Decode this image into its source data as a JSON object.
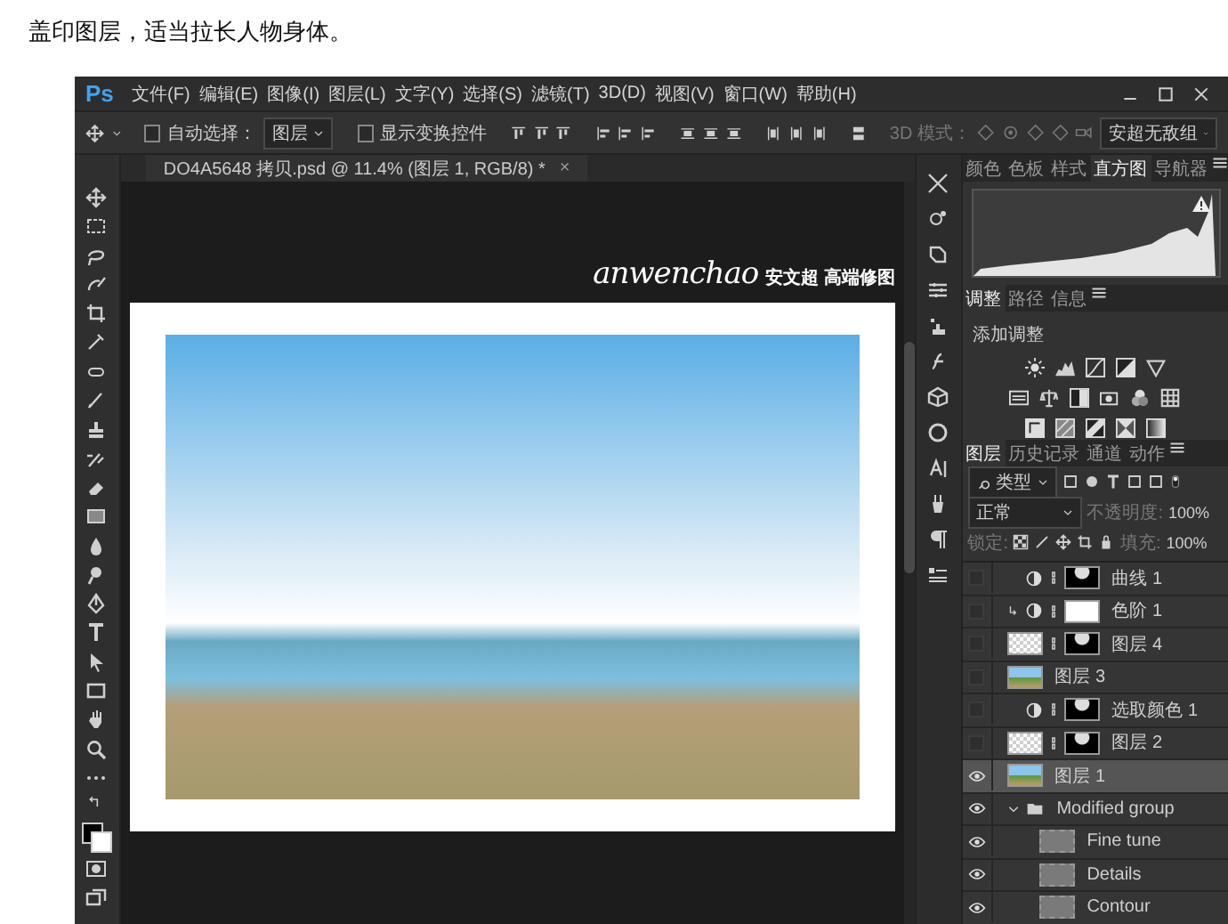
{
  "caption": "盖印图层，适当拉长人物身体。",
  "app": {
    "logo": "Ps",
    "menu": [
      "文件(F)",
      "编辑(E)",
      "图像(I)",
      "图层(L)",
      "文字(Y)",
      "选择(S)",
      "滤镜(T)",
      "3D(D)",
      "视图(V)",
      "窗口(W)",
      "帮助(H)"
    ]
  },
  "options_bar": {
    "auto_select": {
      "label": "自动选择：",
      "checked": false
    },
    "auto_select_target": "图层",
    "show_transform": {
      "label": "显示变换控件",
      "checked": false
    },
    "mode_3d_label": "3D 模式：",
    "workspace": "安超无敌组"
  },
  "document_tab": {
    "title": "DO4A5648 拷贝.psd @ 11.4% (图层 1, RGB/8) *",
    "close": "×"
  },
  "canvas": {
    "logo_script": "anwenchao",
    "logo_text": "安文超 高端修图"
  },
  "top_panel": {
    "tabs": [
      {
        "label": "颜色",
        "selected": false
      },
      {
        "label": "色板",
        "selected": false
      },
      {
        "label": "样式",
        "selected": false
      },
      {
        "label": "直方图",
        "selected": true
      },
      {
        "label": "导航器",
        "selected": false
      }
    ]
  },
  "adjust_panel": {
    "tabs": [
      {
        "label": "调整",
        "selected": true
      },
      {
        "label": "路径",
        "selected": false
      },
      {
        "label": "信息",
        "selected": false
      }
    ],
    "heading": "添加调整"
  },
  "layers_panel": {
    "tabs": [
      {
        "label": "图层",
        "selected": true
      },
      {
        "label": "历史记录",
        "selected": false
      },
      {
        "label": "通道",
        "selected": false
      },
      {
        "label": "动作",
        "selected": false
      }
    ],
    "filter": "类型",
    "blend_mode": "正常",
    "opacity_label": "不透明度:",
    "opacity": "100%",
    "lock_label": "锁定:",
    "fill_label": "填充:",
    "fill": "100%",
    "layers": [
      {
        "name": "曲线 1",
        "kind": "adjustment",
        "mask": true,
        "mask_blank": false,
        "clipped": false,
        "visible": false,
        "selected": false
      },
      {
        "name": "色阶 1",
        "kind": "adjustment",
        "mask": true,
        "mask_blank": true,
        "clipped": true,
        "visible": false,
        "selected": false
      },
      {
        "name": "图层 4",
        "kind": "cutout",
        "mask": true,
        "mask_blank": false,
        "visible": false,
        "selected": false
      },
      {
        "name": "图层 3",
        "kind": "photo",
        "mask": false,
        "visible": false,
        "selected": false
      },
      {
        "name": "选取颜色 1",
        "kind": "adjustment",
        "mask": true,
        "mask_blank": false,
        "clipped": false,
        "visible": false,
        "selected": false
      },
      {
        "name": "图层 2",
        "kind": "cutout",
        "mask": true,
        "mask_blank": false,
        "visible": false,
        "selected": false
      },
      {
        "name": "图层 1",
        "kind": "photo",
        "mask": false,
        "visible": true,
        "selected": true
      },
      {
        "name": "Modified group",
        "kind": "group",
        "expanded": true,
        "visible": true,
        "selected": false,
        "children": [
          {
            "name": "Fine tune",
            "kind": "blank",
            "mask": false,
            "visible": true,
            "selected": false
          },
          {
            "name": "Details",
            "kind": "blank",
            "mask": false,
            "visible": true,
            "selected": false
          },
          {
            "name": "Contour",
            "kind": "blank",
            "mask": false,
            "visible": true,
            "selected": false
          }
        ]
      }
    ]
  }
}
